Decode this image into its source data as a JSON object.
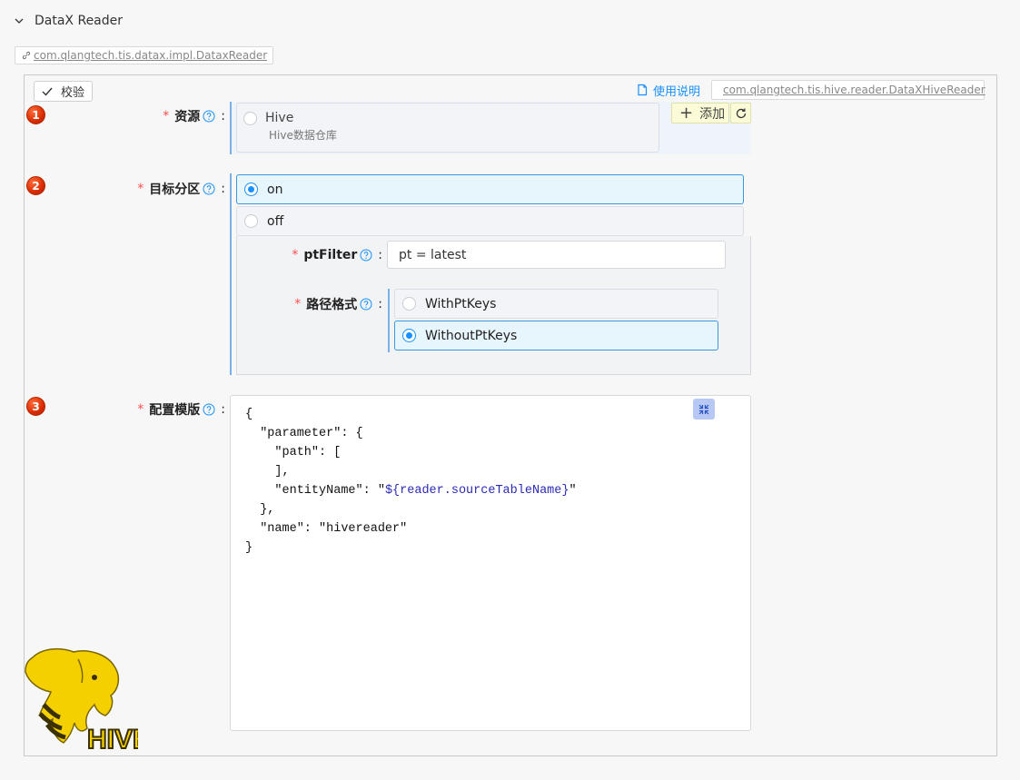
{
  "header": {
    "title": "DataX Reader",
    "impl_class": "com.qlangtech.tis.datax.impl.DataxReader"
  },
  "toolbar": {
    "validate_label": "校验",
    "manual_label": "使用说明",
    "plugin_class": "com.qlangtech.tis.hive.reader.DataXHiveReader"
  },
  "steps": [
    "1",
    "2",
    "3"
  ],
  "resource": {
    "label": "资源",
    "required_mark": "*",
    "option": {
      "name": "Hive",
      "desc": "Hive数据仓库",
      "selected": false
    },
    "add_label": "添加"
  },
  "partition": {
    "label": "目标分区",
    "required_mark": "*",
    "options": [
      {
        "label": "on",
        "selected": true
      },
      {
        "label": "off",
        "selected": false
      }
    ],
    "ptfilter": {
      "label": "ptFilter",
      "required_mark": "*",
      "value": "pt = latest"
    },
    "path_format": {
      "label": "路径格式",
      "required_mark": "*",
      "options": [
        {
          "label": "WithPtKeys",
          "selected": false
        },
        {
          "label": "WithoutPtKeys",
          "selected": true
        }
      ]
    }
  },
  "template": {
    "label": "配置模版",
    "required_mark": "*",
    "lines": [
      "{",
      "  \"parameter\": {",
      "    \"path\": [",
      "    ],",
      "    \"entityName\": \"${reader.sourceTableName}\"",
      "  },",
      "  \"name\": \"hivereader\"",
      "}"
    ]
  },
  "logo": {
    "text": "HIVE"
  },
  "colors": {
    "accent": "#1890ff",
    "required": "#ff4d4f",
    "badge": "#d92c00",
    "logo_yellow": "#f5d000"
  }
}
